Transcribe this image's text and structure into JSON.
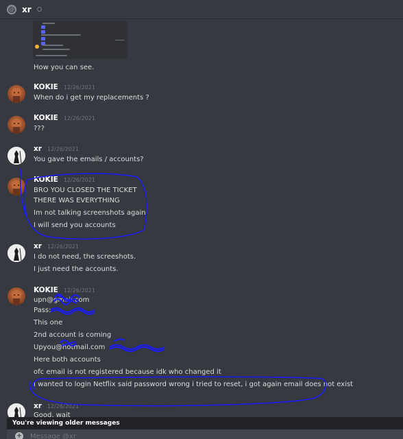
{
  "header": {
    "at_symbol": "@",
    "title": "xr"
  },
  "messages": [
    {
      "lines": [
        "How you can see."
      ]
    },
    {
      "author": "KOKIE",
      "timestamp": "12/26/2021",
      "lines": [
        "When do i get my replacements ?"
      ]
    },
    {
      "author": "KOKIE",
      "timestamp": "12/26/2021",
      "lines": [
        "???"
      ]
    },
    {
      "author": "xr",
      "timestamp": "12/26/2021",
      "lines": [
        "You gave the emails / accounts?"
      ]
    },
    {
      "author": "KOKIE",
      "timestamp": "12/26/2021",
      "lines": [
        "BRO YOU CLOSED THE TICKET",
        "THERE WAS EVERYTHING",
        "Im not talking screenshots again",
        "I will send you accounts"
      ]
    },
    {
      "author": "xr",
      "timestamp": "12/26/2021",
      "lines": [
        "I do not need, the screeshots.",
        "I just need the accounts."
      ]
    },
    {
      "author": "KOKIE",
      "timestamp": "12/26/2021",
      "lines": [
        "upn@gmail.com",
        "Pass:",
        "This one",
        "2nd account is coming",
        "Upyou@hotmail.com",
        "Here both accounts",
        "ofc email is not registered because idk who changed it",
        "I wanted to login Netflix said password wrong i tried to reset, i got again email does not exist"
      ]
    },
    {
      "author": "xr",
      "timestamp": "12/26/2021",
      "lines": [
        "Good, wait"
      ]
    }
  ],
  "older_notice": "You're viewing older messages",
  "composer": {
    "placeholder": "Message @xr"
  },
  "colors": {
    "background": "#36393f",
    "scribble": "#1a1aff",
    "embed": "#2f3136"
  }
}
